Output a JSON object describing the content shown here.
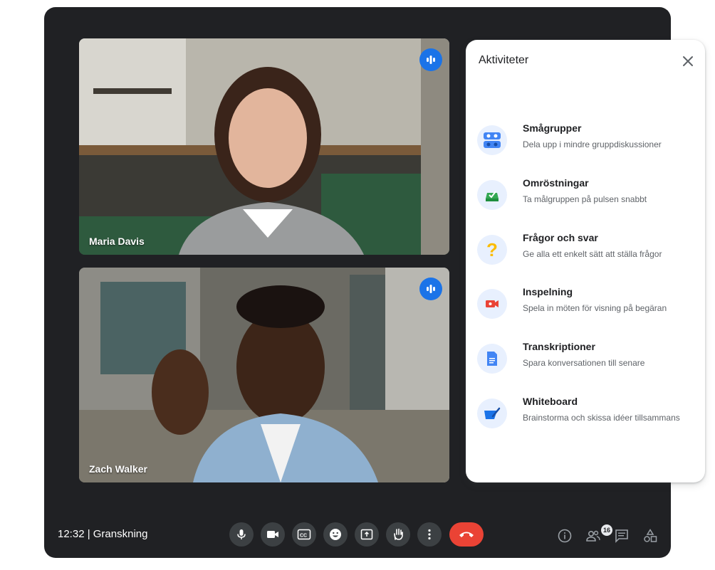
{
  "participants": [
    {
      "name": "Maria Davis"
    },
    {
      "name": "Zach Walker"
    }
  ],
  "panel": {
    "title": "Aktiviteter",
    "items": [
      {
        "title": "Smågrupper",
        "desc": "Dela upp i mindre gruppdiskussioner",
        "icon": "breakout-rooms-icon"
      },
      {
        "title": "Omröstningar",
        "desc": "Ta målgruppen på pulsen snabbt",
        "icon": "polls-icon"
      },
      {
        "title": "Frågor och svar",
        "desc": "Ge alla ett enkelt sätt att ställa frågor",
        "icon": "qa-icon"
      },
      {
        "title": "Inspelning",
        "desc": "Spela in möten för visning på begäran",
        "icon": "recording-icon"
      },
      {
        "title": "Transkriptioner",
        "desc": "Spara konversationen till senare",
        "icon": "transcript-icon"
      },
      {
        "title": "Whiteboard",
        "desc": "Brainstorma och skissa idéer tillsammans",
        "icon": "whiteboard-icon"
      }
    ]
  },
  "bottom_bar": {
    "meeting_info": "12:32 | Granskning",
    "people_count": "16"
  },
  "colors": {
    "background": "#202124",
    "accent_blue": "#1a73e8",
    "hangup_red": "#ea4335",
    "control_gray": "#3c4043"
  }
}
